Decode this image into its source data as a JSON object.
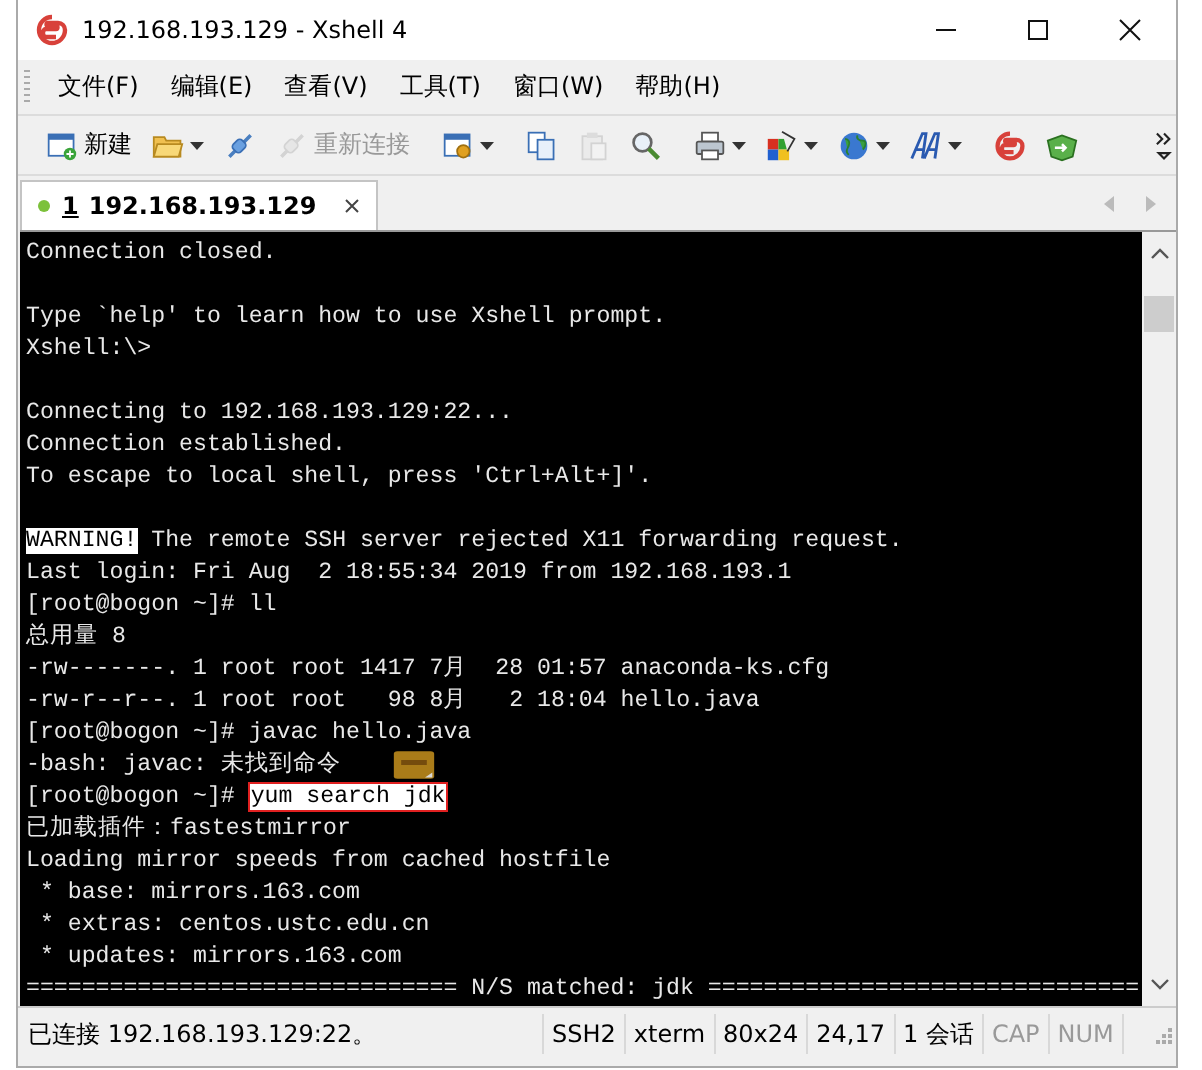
{
  "window": {
    "title": "192.168.193.129 - Xshell 4"
  },
  "menu": [
    "文件(F)",
    "编辑(E)",
    "查看(V)",
    "工具(T)",
    "窗口(W)",
    "帮助(H)"
  ],
  "toolbar": [
    {
      "kind": "new",
      "label": "新建",
      "disabled": false,
      "caret": false
    },
    {
      "kind": "open",
      "disabled": false,
      "caret": true
    },
    {
      "kind": "connect",
      "disabled": false,
      "caret": false
    },
    {
      "kind": "reconnect",
      "label": "重新连接",
      "disabled": true,
      "caret": false
    },
    {
      "kind": "separator"
    },
    {
      "kind": "properties",
      "disabled": false,
      "caret": true
    },
    {
      "kind": "separator"
    },
    {
      "kind": "copy",
      "disabled": false,
      "caret": false
    },
    {
      "kind": "paste",
      "disabled": true,
      "caret": false
    },
    {
      "kind": "find",
      "disabled": false,
      "caret": false
    },
    {
      "kind": "separator"
    },
    {
      "kind": "print",
      "disabled": false,
      "caret": true
    },
    {
      "kind": "colors",
      "disabled": false,
      "caret": true
    },
    {
      "kind": "globe",
      "disabled": false,
      "caret": true
    },
    {
      "kind": "font",
      "disabled": false,
      "caret": true
    },
    {
      "kind": "separator"
    },
    {
      "kind": "logo",
      "disabled": false,
      "caret": false
    },
    {
      "kind": "transfer",
      "disabled": false,
      "caret": false
    },
    {
      "kind": "separator"
    },
    {
      "kind": "more",
      "disabled": false,
      "caret": false
    }
  ],
  "tabs": [
    {
      "number": "1",
      "label": "192.168.193.129",
      "selected": true,
      "connected": true
    }
  ],
  "terminal": {
    "lines": [
      {
        "kind": "text",
        "segments": [
          {
            "text": "Connection closed.",
            "kind": "normal"
          }
        ]
      },
      {
        "kind": "blank"
      },
      {
        "kind": "text",
        "segments": [
          {
            "text": "Type `help' to learn how to use Xshell prompt.",
            "kind": "normal"
          }
        ]
      },
      {
        "kind": "text",
        "segments": [
          {
            "text": "Xshell:\\>",
            "kind": "normal"
          }
        ]
      },
      {
        "kind": "blank"
      },
      {
        "kind": "text",
        "segments": [
          {
            "text": "Connecting to 192.168.193.129:22...",
            "kind": "normal"
          }
        ]
      },
      {
        "kind": "text",
        "segments": [
          {
            "text": "Connection established.",
            "kind": "normal"
          }
        ]
      },
      {
        "kind": "text",
        "segments": [
          {
            "text": "To escape to local shell, press 'Ctrl+Alt+]'.",
            "kind": "normal"
          }
        ]
      },
      {
        "kind": "blank"
      },
      {
        "kind": "text",
        "segments": [
          {
            "text": "WARNING!",
            "kind": "inverse"
          },
          {
            "text": " The remote SSH server rejected X11 forwarding request.",
            "kind": "normal"
          }
        ]
      },
      {
        "kind": "text",
        "segments": [
          {
            "text": "Last login: Fri Aug  2 18:55:34 2019 from 192.168.193.1",
            "kind": "normal"
          }
        ]
      },
      {
        "kind": "text",
        "segments": [
          {
            "text": "[root@bogon ~]# ll",
            "kind": "normal"
          }
        ]
      },
      {
        "kind": "text",
        "segments": [
          {
            "text": "总用量 8",
            "kind": "normal"
          }
        ]
      },
      {
        "kind": "text",
        "segments": [
          {
            "text": "-rw-------. 1 root root 1417 7月  28 01:57 anaconda-ks.cfg",
            "kind": "normal"
          }
        ]
      },
      {
        "kind": "text",
        "segments": [
          {
            "text": "-rw-r--r--. 1 root root   98 8月   2 18:04 hello.java",
            "kind": "normal"
          }
        ]
      },
      {
        "kind": "text",
        "segments": [
          {
            "text": "[root@bogon ~]# javac hello.java",
            "kind": "normal"
          }
        ]
      },
      {
        "kind": "text",
        "segments": [
          {
            "text": "-bash: javac: 未找到命令",
            "kind": "normal"
          }
        ]
      },
      {
        "kind": "text",
        "segments": [
          {
            "text": "[root@bogon ~]# ",
            "kind": "normal"
          },
          {
            "text": "yum search jdk",
            "kind": "boxed"
          }
        ]
      },
      {
        "kind": "text",
        "segments": [
          {
            "text": "已加载插件：fastestmirror",
            "kind": "normal"
          }
        ]
      },
      {
        "kind": "text",
        "segments": [
          {
            "text": "Loading mirror speeds from cached hostfile",
            "kind": "normal"
          }
        ]
      },
      {
        "kind": "text",
        "segments": [
          {
            "text": " * base: mirrors.163.com",
            "kind": "normal"
          }
        ]
      },
      {
        "kind": "text",
        "segments": [
          {
            "text": " * extras: centos.ustc.edu.cn",
            "kind": "normal"
          }
        ]
      },
      {
        "kind": "text",
        "segments": [
          {
            "text": " * updates: mirrors.163.com",
            "kind": "normal"
          }
        ]
      },
      {
        "kind": "text",
        "segments": [
          {
            "text": "=============================== N/S matched: jdk ===============================",
            "kind": "normal"
          }
        ]
      }
    ]
  },
  "status_bar": [
    {
      "text": "已连接 192.168.193.129:22。",
      "disabled": false,
      "kind": "wide"
    },
    {
      "text": "SSH2",
      "disabled": false,
      "kind": "cell"
    },
    {
      "text": "xterm",
      "disabled": false,
      "kind": "cell"
    },
    {
      "text": "80x24",
      "disabled": false,
      "kind": "cell"
    },
    {
      "text": "24,17",
      "disabled": false,
      "kind": "cell"
    },
    {
      "text": "1 会话",
      "disabled": false,
      "kind": "cell"
    },
    {
      "text": "CAP",
      "disabled": true,
      "kind": "cell"
    },
    {
      "text": "NUM",
      "disabled": true,
      "kind": "cell"
    }
  ]
}
